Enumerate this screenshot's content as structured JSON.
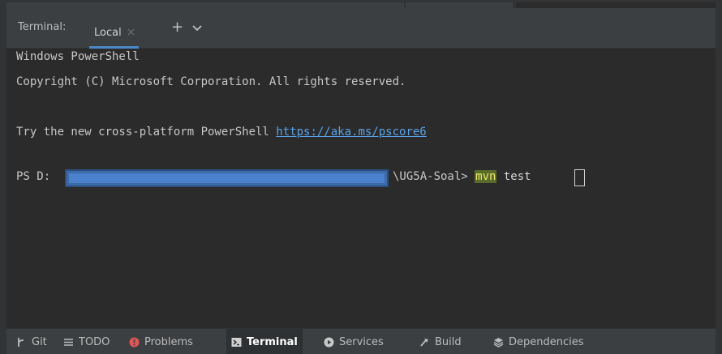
{
  "header": {
    "title": "Terminal:",
    "tab": {
      "label": "Local",
      "close_glyph": "×"
    },
    "add_glyph": "+",
    "icons": [
      "plus-icon",
      "chevron-down-icon",
      "close-icon"
    ]
  },
  "terminal": {
    "lines": [
      "Windows PowerShell",
      "Copyright (C) Microsoft Corporation. All rights reserved.",
      "",
      "Try the new cross-platform PowerShell "
    ],
    "link": "https://aka.ms/pscore6",
    "prompt": {
      "prefix": "PS D:",
      "suffix": "\\UG5A-Soal> ",
      "command": "mvn",
      "argument": " test"
    }
  },
  "bottom_bar": {
    "items": [
      {
        "label": "Git",
        "icon": "git-branch-icon"
      },
      {
        "label": "TODO",
        "icon": "list-icon"
      },
      {
        "label": "Problems",
        "icon": "error-icon"
      },
      {
        "label": "Terminal",
        "icon": "terminal-icon",
        "active": true
      },
      {
        "label": "Services",
        "icon": "play-circle-icon"
      },
      {
        "label": "Build",
        "icon": "hammer-icon"
      },
      {
        "label": "Dependencies",
        "icon": "dependencies-icon"
      }
    ]
  },
  "colors": {
    "background": "#2b2b2b",
    "panel": "#3c3f41",
    "link": "#5aa3e8",
    "accent": "#4a88c7",
    "problems": "#e05555",
    "command_highlight": "#5a6b2a"
  }
}
